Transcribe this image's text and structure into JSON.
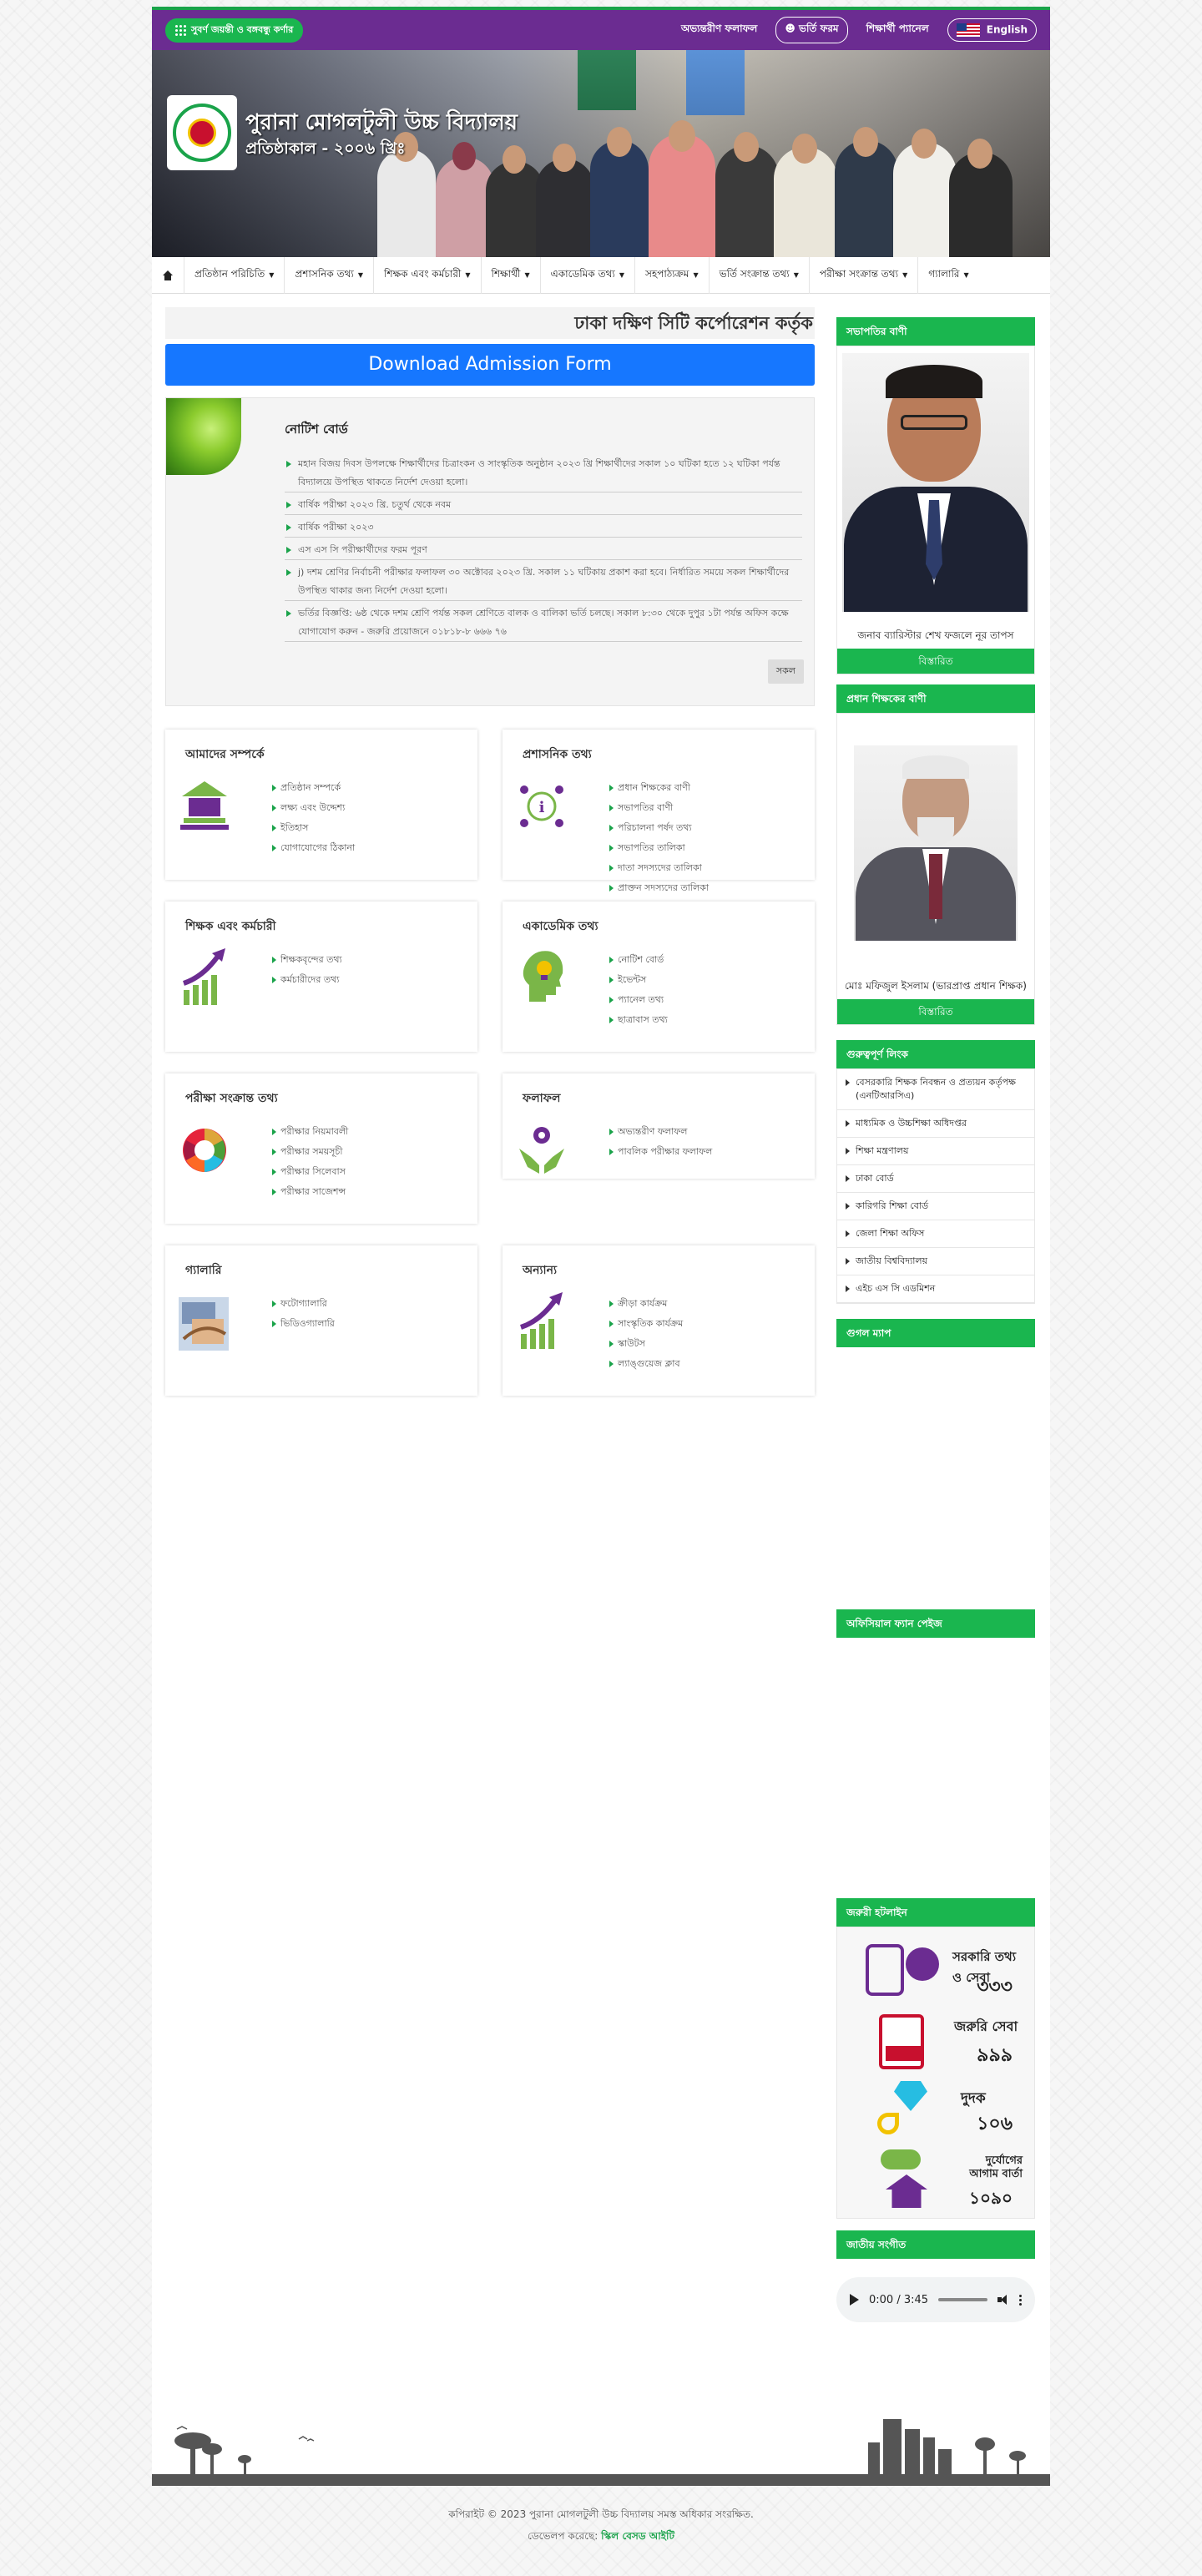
{
  "topbar": {
    "badge": "সুবর্ণ জয়ন্তী ও বঙ্গবন্ধু কর্ণার",
    "links": [
      "অভ্যন্তরীণ ফলাফল",
      "ভর্তি ফরম",
      "শিক্ষার্থী প্যানেল"
    ],
    "language": "English"
  },
  "banner": {
    "school_name": "পুরানা মোগলটুলী উচ্চ বিদ্যালয়",
    "established": "প্রতিষ্ঠাকাল - ২০০৬ খ্রিঃ"
  },
  "nav": {
    "items": [
      "প্রতিষ্ঠান পরিচিতি",
      "প্রশাসনিক তথ্য",
      "শিক্ষক এবং কর্মচারী",
      "শিক্ষার্থী",
      "একাডেমিক তথ্য",
      "সহপাঠ্যক্রম",
      "ভর্তি সংক্রান্ত তথ্য",
      "পরীক্ষা সংক্রান্ত তথ্য",
      "গ্যালারি"
    ]
  },
  "marquee": "ঢাকা দক্ষিণ সিটি কর্পোরেশন কর্তৃক",
  "download_button": "Download Admission Form",
  "notice_board": {
    "title": "নোটিশ বোর্ড",
    "items": [
      "মহান বিজয় দিবস উপলক্ষে শিক্ষার্থীদের চিত্রাংকন ও সাংস্কৃতিক অনুষ্ঠান ২০২৩ খ্রি শিক্ষার্থীদের সকাল ১০ ঘটিকা হতে ১২ ঘটিকা পর্যন্ত বিদ্যালয়ে উপস্থিত থাকতে নির্দেশ দেওয়া হলো।",
      "বার্ষিক পরীক্ষা ২০২৩ খ্রি. চতুর্থ থেকে নবম",
      "বার্ষিক পরীক্ষা ২০২৩",
      "এস এস সি পরীক্ষার্থীদের ফরম পূরণ",
      "j) দশম শ্রেণির নির্বাচনী পরীক্ষার ফলাফল ৩০ অক্টোবর ২০২৩ খ্রি. সকাল ১১ ঘটিকায় প্রকাশ করা হবে। নির্ধারিত সময়ে সকল শিক্ষার্থীদের উপস্থিত থাকার জন্য নির্দেশ দেওয়া হলো।",
      "ভর্তির বিজ্ঞপ্তি: ৬ষ্ঠ থেকে দশম শ্রেণি পর্যন্ত সকল শ্রেণিতে বালক ও বালিকা ভর্তি চলছে। সকাল ৮:৩০ থেকে দুপুর ১টা পর্যন্ত অফিস কক্ষে যোগাযোগ করুন - জরুরি প্রয়োজনে ০১৮১৮-৮ ৬৬৬ ৭৬"
    ],
    "all_button": "সকল"
  },
  "cards": [
    {
      "title": "আমাদের সম্পর্কে",
      "links": [
        "প্রতিষ্ঠান সম্পর্কে",
        "লক্ষ্য এবং উদ্দেশ্য",
        "ইতিহাস",
        "যোগাযোগের ঠিকানা"
      ]
    },
    {
      "title": "প্রশাসনিক তথ্য",
      "links": [
        "প্রধান শিক্ষকের বাণী",
        "সভাপতির বাণী",
        "পরিচালনা পর্ষদ তথ্য",
        "সভাপতির তালিকা",
        "দাতা সদস্যদের তালিকা",
        "প্রাক্তন সদস্যদের তালিকা"
      ]
    },
    {
      "title": "শিক্ষক এবং কর্মচারী",
      "links": [
        "শিক্ষকবৃন্দের তথ্য",
        "কর্মচারীদের তথ্য"
      ]
    },
    {
      "title": "একাডেমিক তথ্য",
      "links": [
        "নোটিশ বোর্ড",
        "ইভেন্টস",
        "প্যানেল তথ্য",
        "ছাত্রাবাস তথ্য"
      ]
    },
    {
      "title": "পরীক্ষা সংক্রান্ত তথ্য",
      "links": [
        "পরীক্ষার নিয়মাবলী",
        "পরীক্ষার সময়সূচী",
        "পরীক্ষার সিলেবাস",
        "পরীক্ষার সাজেশন্স"
      ]
    },
    {
      "title": "ফলাফল",
      "links": [
        "অভ্যন্তরীণ ফলাফল",
        "পাবলিক পরীক্ষার ফলাফল"
      ]
    },
    {
      "title": "গ্যালারি",
      "links": [
        "ফটোগ্যালারি",
        "ভিডিওগ্যালারি"
      ]
    },
    {
      "title": "অন্যান্য",
      "links": [
        "ক্রীড়া কার্যক্রম",
        "সাংস্কৃতিক কার্যক্রম",
        "স্কাউটস",
        "ল্যাঙ্গুয়েজ ক্লাব"
      ]
    }
  ],
  "sidebar": {
    "chairman": {
      "heading": "সভাপতির বাণী",
      "name": "জনাব ব্যারিস্টার শেখ ফজলে নূর তাপস",
      "more": "বিস্তারিত"
    },
    "headmaster": {
      "heading": "প্রধান শিক্ষকের বাণী",
      "name": "মোঃ মফিজুল ইসলাম (ভারপ্রাপ্ত প্রধান শিক্ষক)",
      "more": "বিস্তারিত"
    },
    "important_links": {
      "heading": "গুরুত্বপূর্ণ লিংক",
      "items": [
        "বেসরকারি শিক্ষক নিবন্ধন ও প্রত্যয়ন কর্তৃপক্ষ (এনটিআরসিএ)",
        "মাধ্যমিক ও উচ্চশিক্ষা অধিদপ্তর",
        "শিক্ষা মন্ত্রণালয়",
        "ঢাকা বোর্ড",
        "কারিগরি শিক্ষা বোর্ড",
        "জেলা শিক্ষা অফিস",
        "জাতীয় বিশ্ববিদ্যালয়",
        "এইচ এস সি এডমিশন"
      ]
    },
    "google_map": "গুগল ম্যাপ",
    "facebook": "অফিসিয়াল ফ্যান পেইজ",
    "hotline": {
      "heading": "জরুরী হটলাইন",
      "items": [
        {
          "label": "সরকারি তথ্য ও সেবা",
          "number": "৩৩৩"
        },
        {
          "label": "জরুরি সেবা",
          "number": "৯৯৯"
        },
        {
          "label": "দুদক",
          "number": "১০৬"
        },
        {
          "label": "দুর্যোগের আগাম বার্তা",
          "number": "১০৯০"
        }
      ]
    },
    "anthem": {
      "heading": "জাতীয় সংগীত",
      "time": "0:00 / 3:45"
    }
  },
  "footer": {
    "copyright": "কপিরাইট © 2023 পুরানা মোগলটুলী উচ্চ বিদ্যালয় সমস্ত অধিকার সংরক্ষিত.",
    "developer_prefix": "ডেভেলপ করেছে:",
    "developer_name": "স্কিল বেসড আইটি"
  }
}
